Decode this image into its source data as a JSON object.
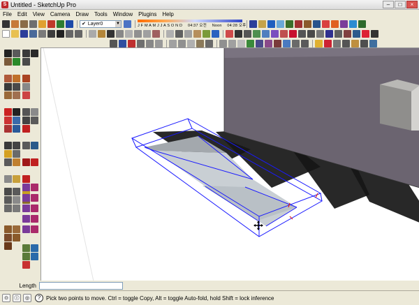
{
  "window": {
    "title": "Untitled - SketchUp Pro"
  },
  "menu": [
    "File",
    "Edit",
    "View",
    "Camera",
    "Draw",
    "Tools",
    "Window",
    "Plugins",
    "Help"
  ],
  "toolbar": {
    "layer_value": "Layer0",
    "months": "J F M A M J J A S O N D",
    "time_left": "04:37 오전",
    "noon": "Noon",
    "time_right": "04:28 오후"
  },
  "vcb": {
    "label": "Length",
    "value": ""
  },
  "status": {
    "message": "Pick two points to move.  Ctrl = toggle Copy, Alt = toggle Auto-fold, hold Shift = lock inference"
  },
  "colors": {
    "selection": "#1a1aff",
    "face": "#c9cfd4",
    "face_top": "#a3a8ad",
    "block": "#6b6470",
    "shadow": "#161616"
  }
}
